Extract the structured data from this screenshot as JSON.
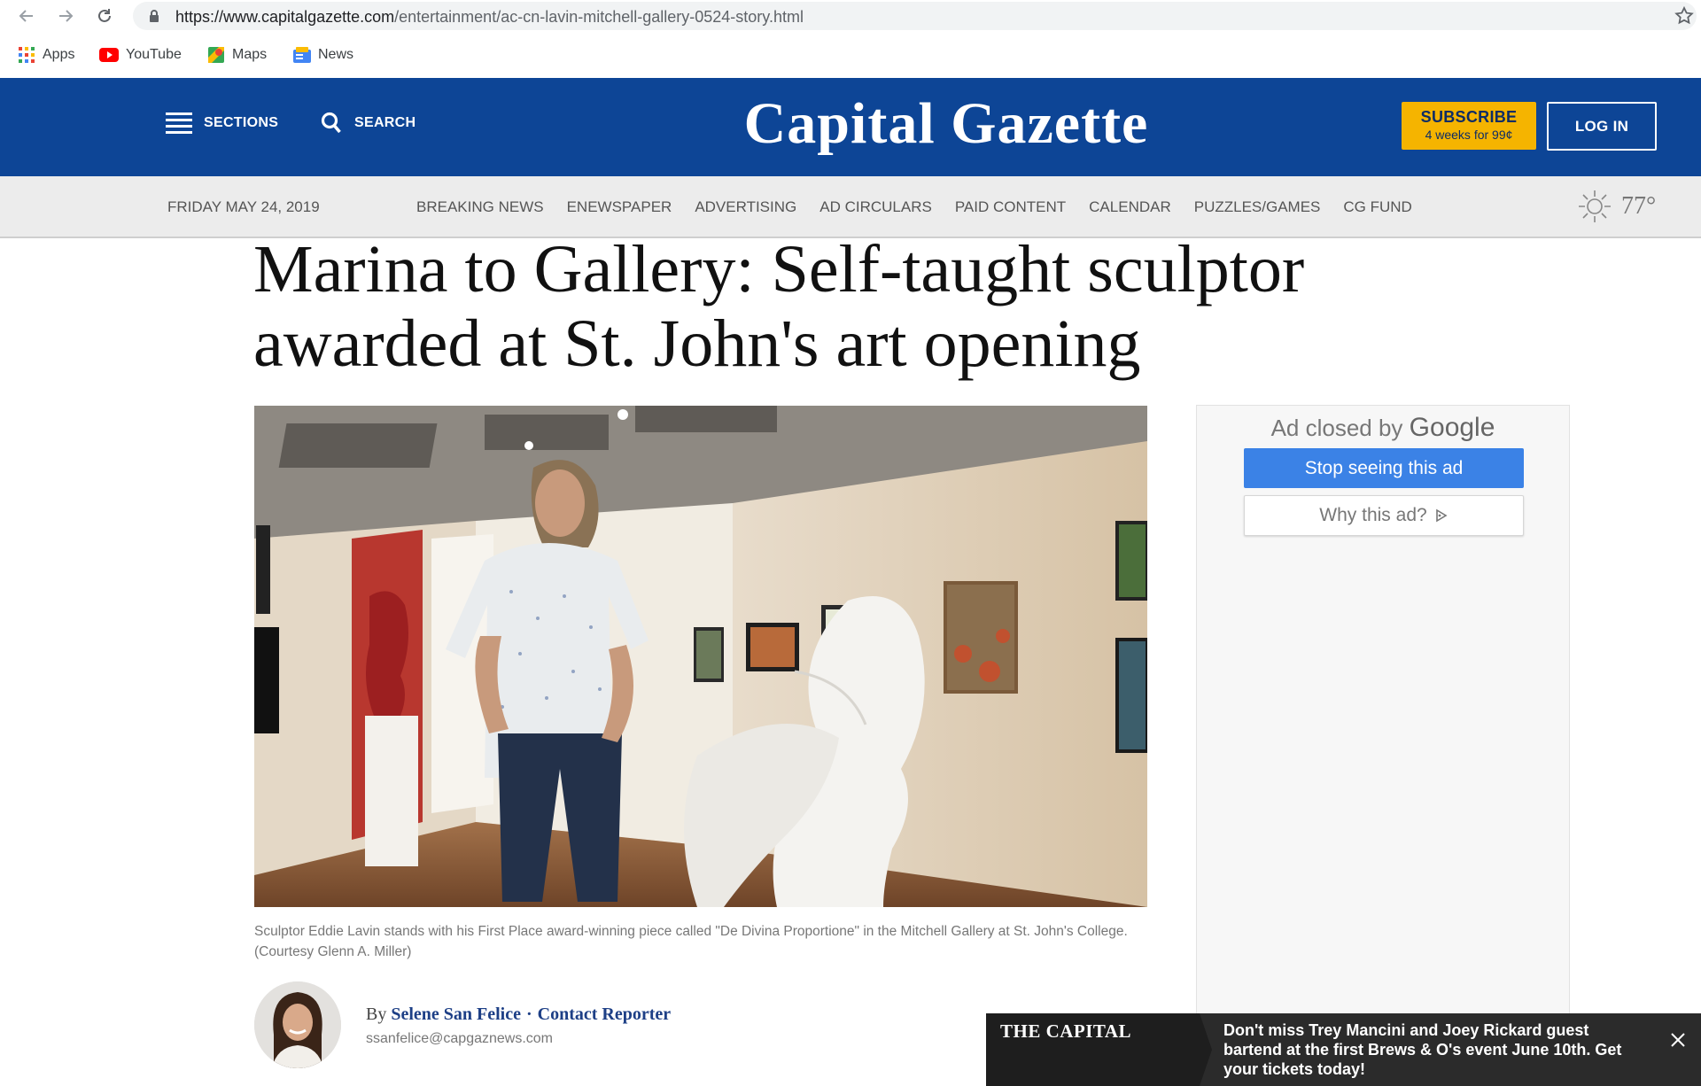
{
  "browser": {
    "url_host": "https://www.capitalgazette.com",
    "url_path": "/entertainment/ac-cn-lavin-mitchell-gallery-0524-story.html",
    "bookmarks": [
      {
        "label": "Apps",
        "icon": "apps-grid-icon"
      },
      {
        "label": "YouTube",
        "icon": "youtube-icon"
      },
      {
        "label": "Maps",
        "icon": "maps-icon"
      },
      {
        "label": "News",
        "icon": "news-icon"
      }
    ]
  },
  "masthead": {
    "sections_label": "SECTIONS",
    "search_label": "SEARCH",
    "logo": "Capital Gazette",
    "subscribe_label": "SUBSCRIBE",
    "subscribe_offer": "4 weeks for 99¢",
    "login_label": "LOG IN",
    "brand_color": "#0d4596",
    "subscribe_color": "#f5b400"
  },
  "subnav": {
    "date": "FRIDAY MAY 24, 2019",
    "links": [
      "BREAKING NEWS",
      "ENEWSPAPER",
      "ADVERTISING",
      "AD CIRCULARS",
      "PAID CONTENT",
      "CALENDAR",
      "PUZZLES/GAMES",
      "CG FUND"
    ],
    "temperature": "77°",
    "weather_icon": "sun-icon"
  },
  "article": {
    "headline": "Marina to Gallery: Self-taught sculptor awarded at St. John's art opening",
    "caption": "Sculptor Eddie Lavin stands with his First Place award-winning piece called \"De Divina Proportione\" in the Mitchell Gallery at St. John's College. (Courtesy Glenn A. Miller)",
    "byline_prefix": "By",
    "author": "Selene San Felice",
    "separator": "·",
    "contact_label": "Contact Reporter",
    "email": "ssanfelice@capgaznews.com"
  },
  "ad": {
    "closed_text": "Ad closed by",
    "closed_brand": "Google",
    "stop_label": "Stop seeing this ad",
    "why_label": "Why this ad?",
    "button_color": "#3b82e6"
  },
  "promo": {
    "brand": "THE CAPITAL",
    "message": "Don't miss Trey Mancini and Joey Rickard guest bartend at the first Brews & O's event June 10th. Get your tickets today!"
  }
}
